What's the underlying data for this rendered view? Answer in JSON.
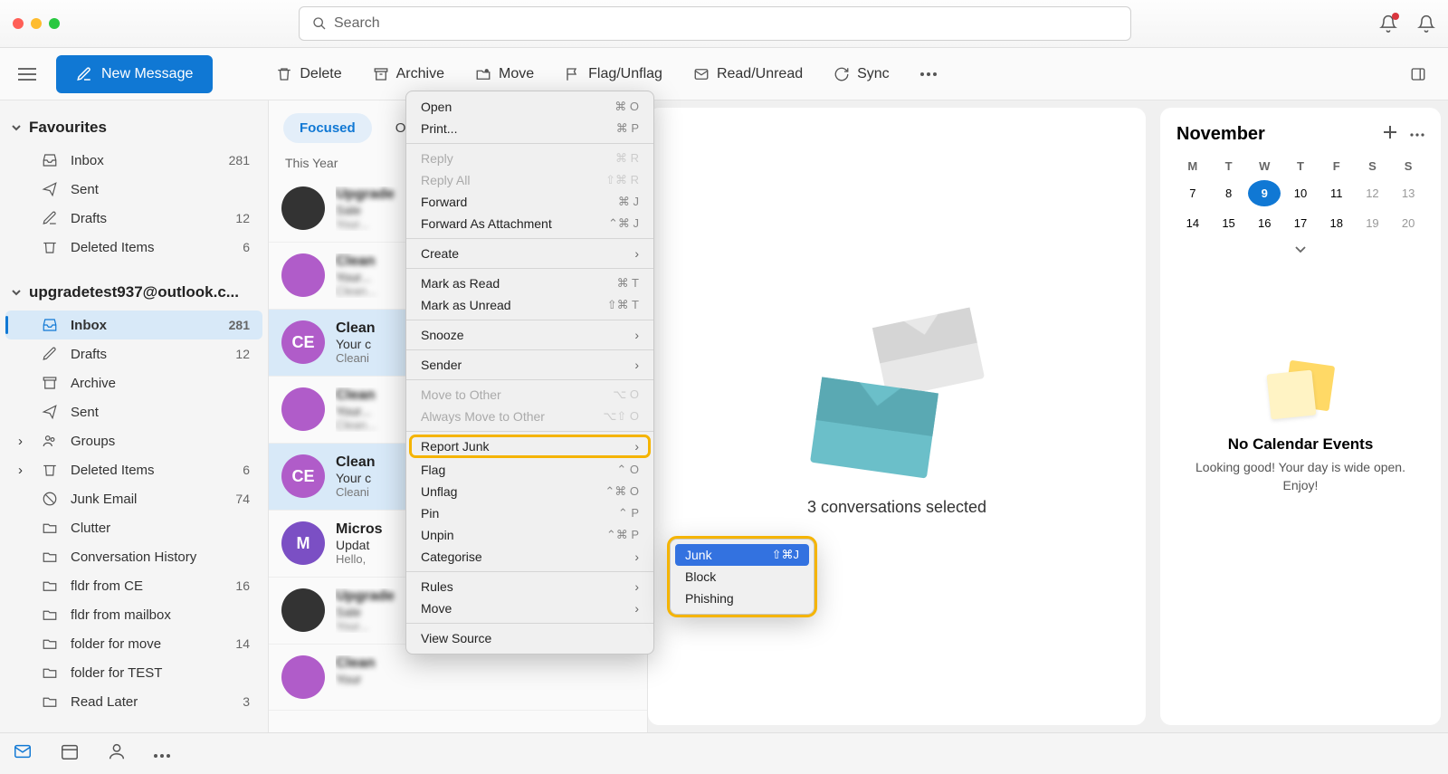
{
  "titlebar": {
    "search_placeholder": "Search"
  },
  "toolbar": {
    "new_message": "New Message",
    "delete": "Delete",
    "archive": "Archive",
    "move": "Move",
    "flag": "Flag/Unflag",
    "read": "Read/Unread",
    "sync": "Sync"
  },
  "sidebar": {
    "favourites_label": "Favourites",
    "account_label": "upgradetest937@outlook.c...",
    "fav": {
      "inbox": {
        "label": "Inbox",
        "count": "281"
      },
      "sent": {
        "label": "Sent"
      },
      "drafts": {
        "label": "Drafts",
        "count": "12"
      },
      "deleted": {
        "label": "Deleted Items",
        "count": "6"
      }
    },
    "acct": {
      "inbox": {
        "label": "Inbox",
        "count": "281"
      },
      "drafts": {
        "label": "Drafts",
        "count": "12"
      },
      "archive": {
        "label": "Archive"
      },
      "sent": {
        "label": "Sent"
      },
      "groups": {
        "label": "Groups"
      },
      "deleted": {
        "label": "Deleted Items",
        "count": "6"
      },
      "junk": {
        "label": "Junk Email",
        "count": "74"
      },
      "clutter": {
        "label": "Clutter"
      },
      "conv_hist": {
        "label": "Conversation History"
      },
      "fldr_ce": {
        "label": "fldr from CE",
        "count": "16"
      },
      "fldr_mailbox": {
        "label": "fldr from mailbox"
      },
      "folder_move": {
        "label": "folder for move",
        "count": "14"
      },
      "folder_test": {
        "label": "folder for TEST"
      },
      "read_later": {
        "label": "Read Later",
        "count": "3"
      }
    }
  },
  "msglist": {
    "tab_focused": "Focused",
    "tab_other": "Oth",
    "year_label": "This Year",
    "items": [
      {
        "avatar_bg": "#333",
        "initials": "",
        "sender": "Upgrade",
        "subj": "Sale",
        "prev": "Your..."
      },
      {
        "avatar_bg": "#b05cc9",
        "initials": "",
        "sender": "Clean",
        "subj": "Your...",
        "prev": "Clean..."
      },
      {
        "avatar_bg": "#b05cc9",
        "initials": "CE",
        "sender": "Clean",
        "subj": "Your c",
        "prev": "Cleani",
        "selected": true
      },
      {
        "avatar_bg": "#b05cc9",
        "initials": "",
        "sender": "Clean",
        "subj": "Your...",
        "prev": "Clean..."
      },
      {
        "avatar_bg": "#b05cc9",
        "initials": "CE",
        "sender": "Clean",
        "subj": "Your c",
        "prev": "Cleani",
        "selected": true
      },
      {
        "avatar_bg": "#7b4fc4",
        "initials": "M",
        "sender": "Micros",
        "subj": "Updat",
        "prev": "Hello,",
        "mletter": true
      },
      {
        "avatar_bg": "#333",
        "initials": "",
        "sender": "Upgrade",
        "subj": "Sale",
        "prev": "Your..."
      },
      {
        "avatar_bg": "#b05cc9",
        "initials": "",
        "sender": "Clean",
        "subj": "Your",
        "prev": ""
      }
    ]
  },
  "reading": {
    "selected_text": "3 conversations selected"
  },
  "calendar": {
    "month": "November",
    "dow": [
      "M",
      "T",
      "W",
      "T",
      "F",
      "S",
      "S"
    ],
    "weeks": [
      [
        "7",
        "8",
        "9",
        "10",
        "11",
        "12",
        "13"
      ],
      [
        "14",
        "15",
        "16",
        "17",
        "18",
        "19",
        "20"
      ]
    ],
    "today_index": [
      0,
      2
    ],
    "empty_title": "No Calendar Events",
    "empty_sub": "Looking good! Your day is wide open. Enjoy!"
  },
  "context_menu": {
    "open": {
      "label": "Open",
      "sc": "⌘ O"
    },
    "print": {
      "label": "Print...",
      "sc": "⌘ P"
    },
    "reply": {
      "label": "Reply",
      "sc": "⌘ R"
    },
    "reply_all": {
      "label": "Reply All",
      "sc": "⇧⌘ R"
    },
    "forward": {
      "label": "Forward",
      "sc": "⌘ J"
    },
    "forward_att": {
      "label": "Forward As Attachment",
      "sc": "⌃⌘ J"
    },
    "create": {
      "label": "Create"
    },
    "mark_read": {
      "label": "Mark as Read",
      "sc": "⌘ T"
    },
    "mark_unread": {
      "label": "Mark as Unread",
      "sc": "⇧⌘ T"
    },
    "snooze": {
      "label": "Snooze"
    },
    "sender": {
      "label": "Sender"
    },
    "move_other": {
      "label": "Move to Other",
      "sc": "⌥ O"
    },
    "always_move": {
      "label": "Always Move to Other",
      "sc": "⌥⇧ O"
    },
    "report_junk": {
      "label": "Report Junk"
    },
    "flag": {
      "label": "Flag",
      "sc": "⌃ O"
    },
    "unflag": {
      "label": "Unflag",
      "sc": "⌃⌘ O"
    },
    "pin": {
      "label": "Pin",
      "sc": "⌃ P"
    },
    "unpin": {
      "label": "Unpin",
      "sc": "⌃⌘ P"
    },
    "categorise": {
      "label": "Categorise"
    },
    "rules": {
      "label": "Rules"
    },
    "move": {
      "label": "Move"
    },
    "view_source": {
      "label": "View Source"
    }
  },
  "submenu": {
    "junk": {
      "label": "Junk",
      "sc": "⇧⌘J"
    },
    "block": {
      "label": "Block"
    },
    "phishing": {
      "label": "Phishing"
    }
  }
}
